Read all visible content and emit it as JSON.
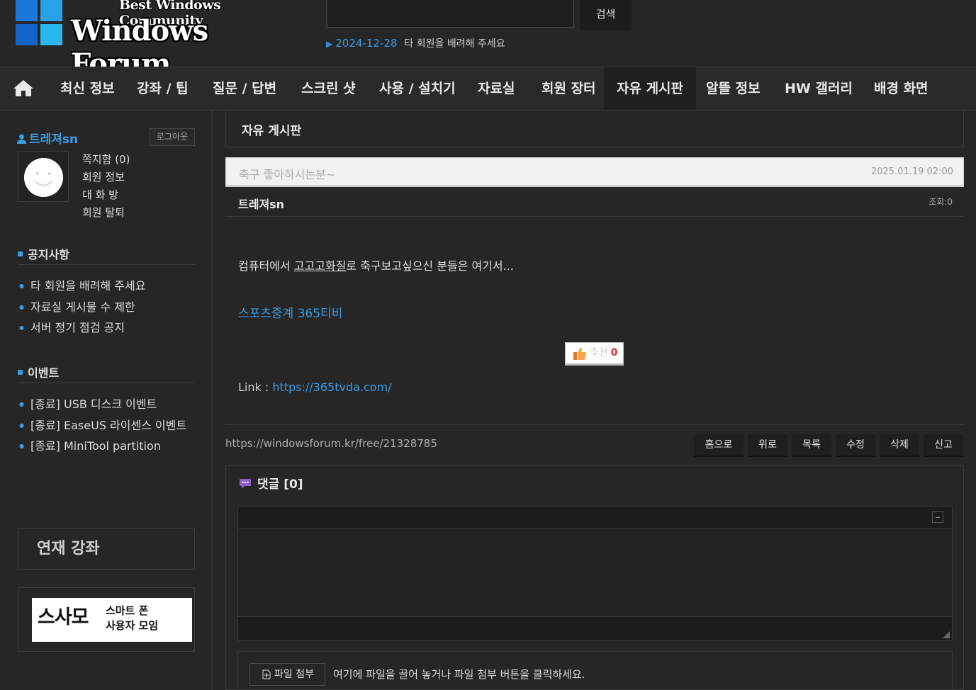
{
  "header": {
    "logo_tagline": "Best Windows Community",
    "logo_name": "Windows Forum",
    "search_value": "",
    "search_button": "검색",
    "notice_date": "2024-12-28",
    "notice_text": "타 회원을 배려해 주세요"
  },
  "nav": {
    "items": [
      "최신 정보",
      "강좌 / 팁",
      "질문 / 답변",
      "스크린 샷",
      "사용 / 설치기",
      "자료실",
      "회원 장터",
      "자유 게시판",
      "알뜰 정보",
      "HW 갤러리",
      "배경 화면"
    ],
    "active": "자유 게시판"
  },
  "sidebar": {
    "username": "트레져sn",
    "logout": "로그아웃",
    "user_menu": [
      "쪽지함 (0)",
      "회원 정보",
      "대 화 방",
      "회원 탈퇴"
    ],
    "notice_heading": "공지사항",
    "notices": [
      "타 회원을 배려해 주세요",
      "자료실 게시물 수 제한",
      "서버 정기 점검 공지"
    ],
    "event_heading": "이벤트",
    "events": [
      "[종료] USB 디스크 이벤트",
      "[종료] EaseUS 라이센스 이벤트",
      "[종료] MiniTool partition"
    ],
    "series_title": "연재 강좌",
    "banner_big": "스사모",
    "banner_small_1": "스마트 폰",
    "banner_small_2": "사용자 모임"
  },
  "post": {
    "board_title": "자유 게시판",
    "title": "축구 좋아하시는분~",
    "date": "2025.01.19 02:00",
    "author": "트레져sn",
    "views": "조회:0",
    "body_pre": "컴퓨터에서 ",
    "body_underlined": "고고고화질",
    "body_post": "로 축구보고싶으신 분들은 여기서...",
    "link_text": "스포츠중계 365티비",
    "like_label": "추천",
    "like_count": "0",
    "link_label": "Link : ",
    "link_url": "https://365tvda.com/",
    "permalink": "https://windowsforum.kr/free/21328785"
  },
  "actions": [
    "홈으로",
    "위로",
    "목록",
    "수정",
    "삭제",
    "신고"
  ],
  "comments": {
    "heading": "댓글 [0]",
    "attach_button": "파일 첨부",
    "attach_hint": "여기에 파일을 끌어 놓거나 파일 첨부 버튼을 클릭하세요."
  },
  "colors": {
    "accent": "#3b9be3",
    "background": "#262626"
  }
}
